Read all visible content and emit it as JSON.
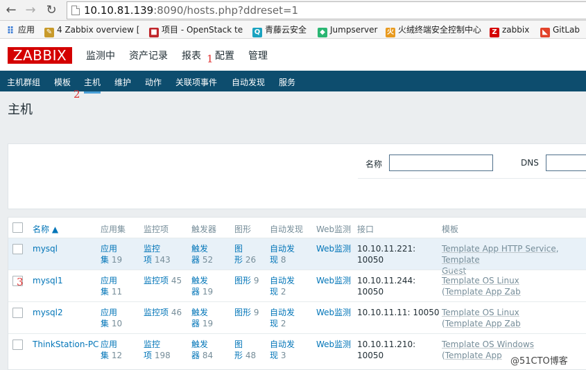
{
  "browser": {
    "url_host": "10.10.81.139",
    "url_rest": ":8090/hosts.php?ddreset=1",
    "bookmarks": [
      {
        "label": "应用",
        "color": "#3a7bd5"
      },
      {
        "label": "4 Zabbix overview [",
        "color": "#c89a2a"
      },
      {
        "label": "项目 - OpenStack te",
        "color": "#c0282d"
      },
      {
        "label": "青藤云安全",
        "color": "#1aa3c0"
      },
      {
        "label": "Jumpserver",
        "color": "#2bb673"
      },
      {
        "label": "火绒终端安全控制中心",
        "color": "#e89a1f"
      },
      {
        "label": "zabbix",
        "color": "#d40000"
      },
      {
        "label": "GitLab",
        "color": "#e2432a"
      }
    ]
  },
  "header": {
    "logo": "ZABBIX",
    "menu": [
      "监测中",
      "资产记录",
      "报表",
      "配置",
      "管理"
    ],
    "mark1": "1"
  },
  "subnav": {
    "items": [
      "主机群组",
      "模板",
      "主机",
      "维护",
      "动作",
      "关联项事件",
      "自动发现",
      "服务"
    ],
    "mark2": "2"
  },
  "page": {
    "title": "主机"
  },
  "filter": {
    "name_label": "名称",
    "name_value": "",
    "dns_label": "DNS",
    "dns_value": ""
  },
  "table": {
    "headers": [
      "名称 ▲",
      "应用集",
      "监控项",
      "触发器",
      "图形",
      "自动发现",
      "Web监测",
      "接口",
      "模板"
    ],
    "mark3": "3",
    "rows": [
      {
        "name": "mysql",
        "app_label": "应用\n集",
        "app_count": "19",
        "items_label": "监控\n项",
        "items_count": "143",
        "trig_label": "触发\n器",
        "trig_count": "52",
        "graph_label": "图\n形",
        "graph_count": "26",
        "disc_label": "自动发\n现",
        "disc_count": "8",
        "web": "Web监测",
        "iface": "10.10.11.221:\n10050",
        "tpl1": "Template App HTTP Service",
        "tpl_sep": ", ",
        "tpl2": "Template",
        "tpl3": "Guest"
      },
      {
        "name": "mysql1",
        "app_label": "应用\n集",
        "app_count": "11",
        "items_label": "监控项",
        "items_count": "45",
        "trig_label": "触发\n器",
        "trig_count": "19",
        "graph_label": "图形",
        "graph_count": "9",
        "disc_label": "自动发\n现",
        "disc_count": "2",
        "web": "Web监测",
        "iface": "10.10.11.244:\n10050",
        "tpl1": "Template OS Linux",
        "tpl_sep": " (",
        "tpl2": "Template App Zab",
        "tpl3": ""
      },
      {
        "name": "mysql2",
        "app_label": "应用\n集",
        "app_count": "10",
        "items_label": "监控项",
        "items_count": "46",
        "trig_label": "触发\n器",
        "trig_count": "19",
        "graph_label": "图形",
        "graph_count": "9",
        "disc_label": "自动发\n现",
        "disc_count": "2",
        "web": "Web监测",
        "iface": "10.10.11.11: 10050",
        "tpl1": "Template OS Linux",
        "tpl_sep": " (",
        "tpl2": "Template App Zab",
        "tpl3": ""
      },
      {
        "name": "ThinkStation-PC",
        "app_label": "应用\n集",
        "app_count": "12",
        "items_label": "监控\n项",
        "items_count": "198",
        "trig_label": "触发\n器",
        "trig_count": "84",
        "graph_label": "图\n形",
        "graph_count": "48",
        "disc_label": "自动发\n现",
        "disc_count": "3",
        "web": "Web监测",
        "iface": "10.10.11.210:\n10050",
        "tpl1": "Template OS Windows",
        "tpl_sep": " (",
        "tpl2": "Template App",
        "tpl3": ""
      }
    ]
  },
  "watermark": "@51CTO博客"
}
